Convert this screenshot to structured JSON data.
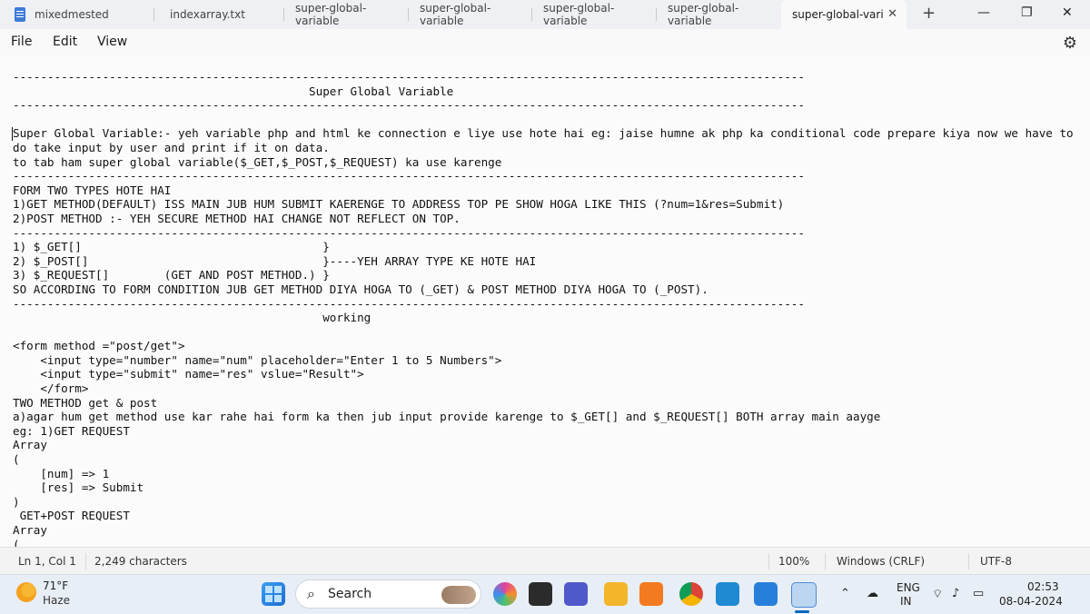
{
  "tabs": [
    {
      "label": "mixedmested"
    },
    {
      "label": "indexarray.txt"
    },
    {
      "label": "super-global-variable"
    },
    {
      "label": "super-global-variable"
    },
    {
      "label": "super-global-variable"
    },
    {
      "label": "super-global-variable"
    },
    {
      "label": "super-global-vari",
      "active": true
    }
  ],
  "window": {
    "close_tab": "✕",
    "new_tab": "+",
    "minimize": "—",
    "maximize": "❐",
    "close": "✕"
  },
  "menu": {
    "file": "File",
    "edit": "Edit",
    "view": "View",
    "settings_icon": "gear-icon"
  },
  "editor": {
    "text": "-------------------------------------------------------------------------------------------------------------------\n                                           Super Global Variable\n-------------------------------------------------------------------------------------------------------------------\n\nSuper Global Variable:- yeh variable php and html ke connection e liye use hote hai eg: jaise humne ak php ka conditional code prepare kiya now we have to\ndo take input by user and print if it on data.\nto tab ham super global variable($_GET,$_POST,$_REQUEST) ka use karenge\n-------------------------------------------------------------------------------------------------------------------\nFORM TWO TYPES HOTE HAI\n1)GET METHOD(DEFAULT) ISS MAIN JUB HUM SUBMIT KAERENGE TO ADDRESS TOP PE SHOW HOGA LIKE THIS (?num=1&res=Submit)\n2)POST METHOD :- YEH SECURE METHOD HAI CHANGE NOT REFLECT ON TOP.\n-------------------------------------------------------------------------------------------------------------------\n1) $_GET[]                                   }\n2) $_POST[]                                  }----YEH ARRAY TYPE KE HOTE HAI\n3) $_REQUEST[]        (GET AND POST METHOD.) }\nSO ACCORDING TO FORM CONDITION JUB GET METHOD DIYA HOGA TO (_GET) & POST METHOD DIYA HOGA TO (_POST).\n-------------------------------------------------------------------------------------------------------------------\n                                             working\n\n<form method =\"post/get\">\n    <input type=\"number\" name=\"num\" placeholder=\"Enter 1 to 5 Numbers\">\n    <input type=\"submit\" name=\"res\" vslue=\"Result\">\n    </form>\nTWO METHOD get & post\na)agar hum get method use kar rahe hai form ka then jub input provide karenge to $_GET[] and $_REQUEST[] BOTH array main aayge\neg: 1)GET REQUEST\nArray\n(\n    [num] => 1\n    [res] => Submit\n)\n GET+POST REQUEST\nArray\n("
  },
  "status": {
    "position": "Ln 1, Col 1",
    "characters": "2,249 characters",
    "zoom": "100%",
    "line_ending": "Windows (CRLF)",
    "encoding": "UTF-8"
  },
  "taskbar": {
    "temperature": "71°F",
    "condition": "Haze",
    "search_placeholder": "Search",
    "language_line1": "ENG",
    "language_line2": "IN",
    "time": "02:53",
    "date": "08-04-2024"
  }
}
